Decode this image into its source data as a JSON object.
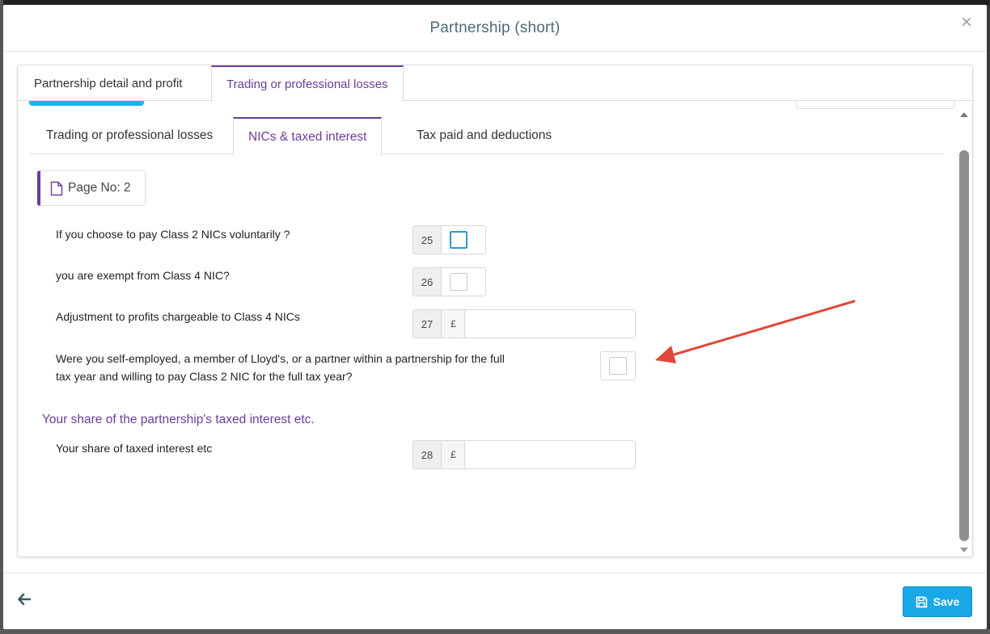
{
  "dialog": {
    "title": "Partnership (short)",
    "close_glyph": "×"
  },
  "outer_tabs": [
    {
      "label": "Partnership detail and profit",
      "active": false
    },
    {
      "label": "Trading or professional losses",
      "active": true
    }
  ],
  "inner_tabs": [
    {
      "label": "Trading or professional losses",
      "active": false
    },
    {
      "label": "NICs & taxed interest",
      "active": true
    },
    {
      "label": "Tax paid and deductions",
      "active": false
    }
  ],
  "page_badge": {
    "label": "Page No: 2",
    "icon": "document-icon"
  },
  "rows": [
    {
      "label": "If you choose to pay Class 2 NICs voluntarily ?",
      "box": "25",
      "type": "checkbox",
      "checked": false,
      "focused": true
    },
    {
      "label": "you are exempt from Class 4 NIC?",
      "box": "26",
      "type": "checkbox",
      "checked": false
    },
    {
      "label": "Adjustment to profits chargeable to Class 4 NICs",
      "box": "27",
      "type": "amount",
      "currency": "£",
      "value": ""
    },
    {
      "label_line1": "Were you self-employed, a member of Lloyd's, or a partner within a partnership for the full",
      "label_line2": "tax year and willing to pay Class 2 NIC for the full tax year?",
      "type": "checkbox",
      "checked": false
    }
  ],
  "section": {
    "heading": "Your share of the partnership's taxed interest etc.",
    "rows": [
      {
        "label": "Your share of taxed interest etc",
        "box": "28",
        "type": "amount",
        "currency": "£",
        "value": ""
      }
    ]
  },
  "footer": {
    "back_icon": "arrow-left-icon",
    "save_label": "Save",
    "save_icon": "floppy-disk-icon"
  },
  "colors": {
    "accent_purple": "#6a3d9a",
    "save_blue": "#19a8e6",
    "title_slate": "#4d6b78",
    "annotation_red": "#e0483a"
  }
}
